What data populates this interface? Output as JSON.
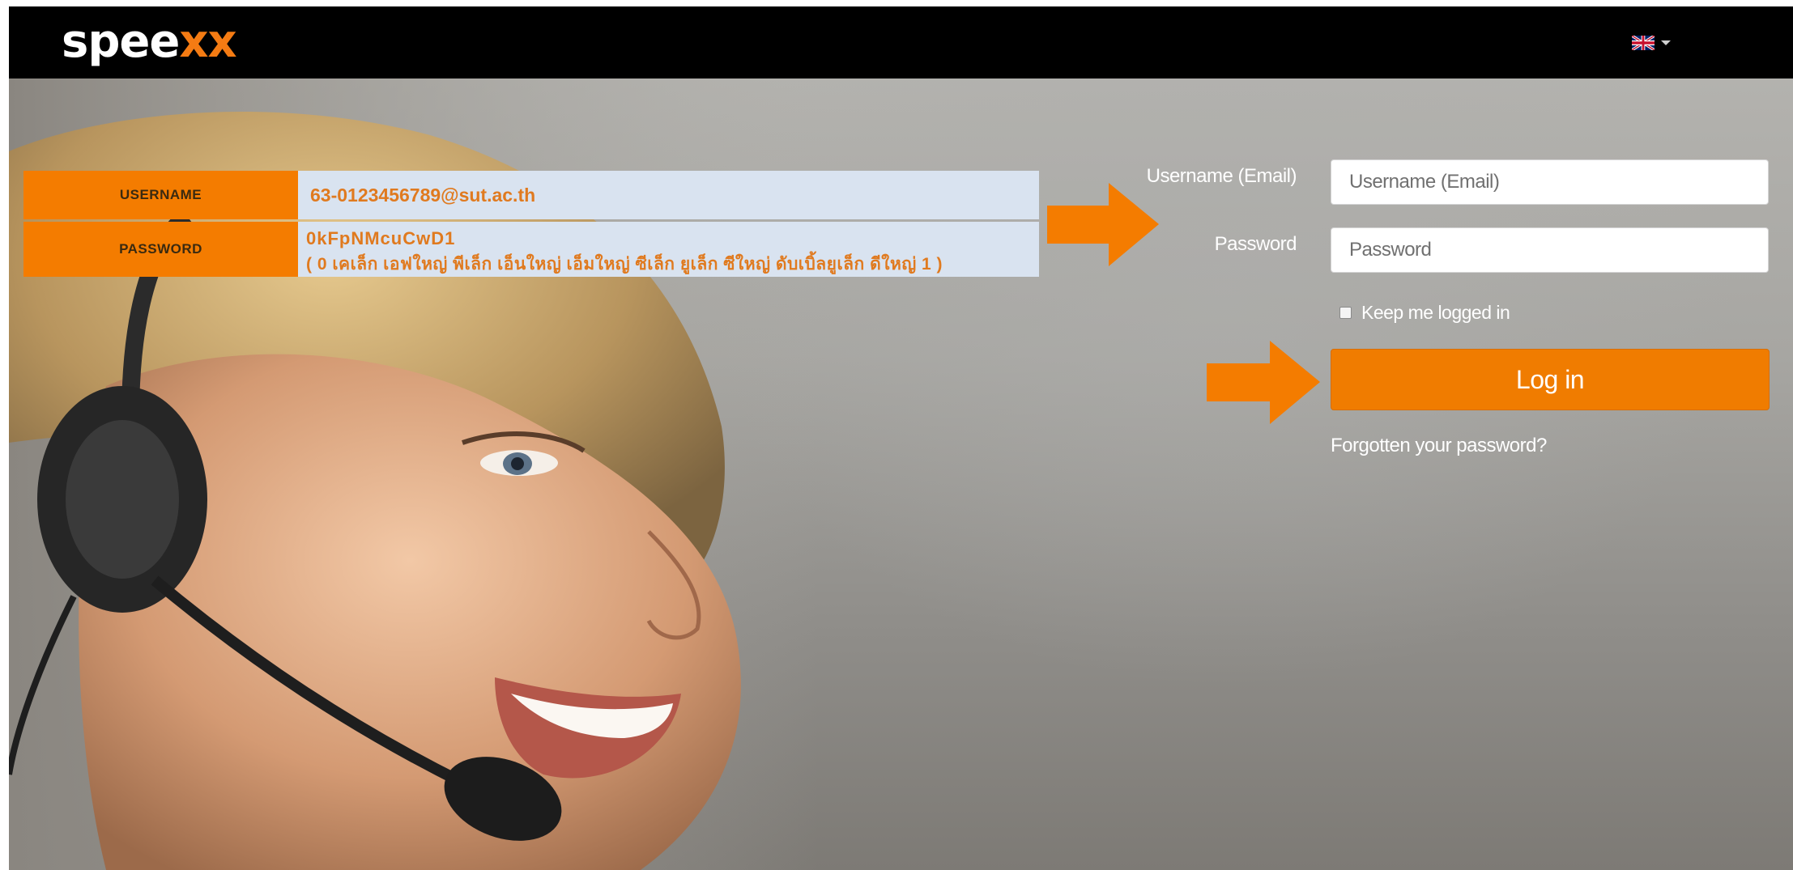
{
  "header": {
    "logo": {
      "main": "spee",
      "accent": "x",
      "tail": "x"
    },
    "language": {
      "flag_icon": "uk-flag-icon",
      "caret_icon": "caret-down-icon"
    }
  },
  "credentials_overlay": {
    "username": {
      "label": "USERNAME",
      "value": "63-0123456789@sut.ac.th"
    },
    "password": {
      "label": "PASSWORD",
      "value": "0kFpNMcuCwD1",
      "hint": "( 0 เคเล็ก เอฟใหญ่ พีเล็ก เอ็นใหญ่ เอ็มใหญ่ ซีเล็ก ยูเล็ก ซีใหญ่ ดับเบิ้ลยูเล็ก ดีใหญ่ 1 )"
    }
  },
  "login_form": {
    "username_label": "Username (Email)",
    "username_placeholder": "Username (Email)",
    "password_label": "Password",
    "password_placeholder": "Password",
    "keep_logged_in": "Keep me logged in",
    "login_button": "Log in",
    "forgot_link": "Forgotten your password?"
  },
  "colors": {
    "brand_orange": "#f47b13",
    "button_orange": "#f07c00",
    "overlay_value_bg": "#d9e3f0",
    "topbar": "#000000"
  }
}
